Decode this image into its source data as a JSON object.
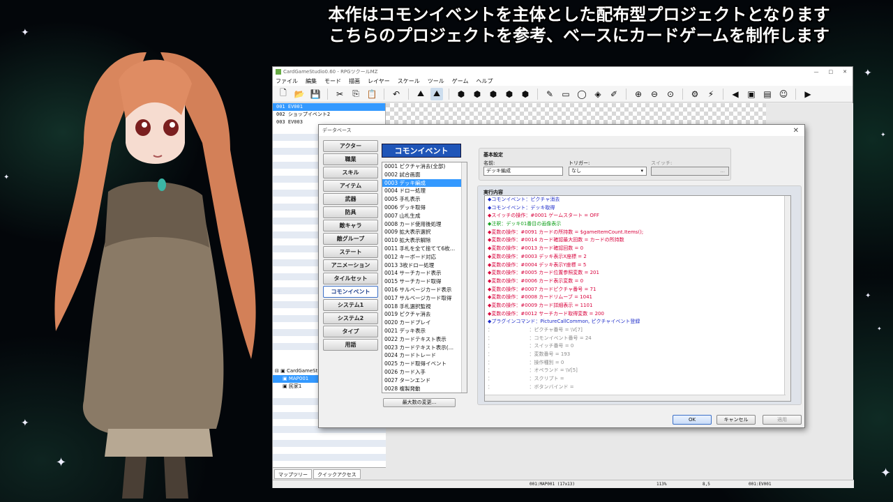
{
  "caption": {
    "line1": "本作はコモンイベントを主体とした配布型プロジェクトとなります",
    "line2": "こちらのプロジェクトを参考、ベースにカードゲームを制作します"
  },
  "window": {
    "title": "CardGameStudio0.60 - RPGツクールMZ",
    "controls": [
      "—",
      "□",
      "✕"
    ]
  },
  "menu": [
    "ファイル",
    "編集",
    "モード",
    "描画",
    "レイヤー",
    "スケール",
    "ツール",
    "ゲーム",
    "ヘルプ"
  ],
  "left_events": [
    {
      "label": "001 EV001",
      "selected": true
    },
    {
      "label": "002 ショップイベント2",
      "selected": false
    },
    {
      "label": "003 EV003",
      "selected": false
    }
  ],
  "map_tree": [
    {
      "label": "CardGameStudio",
      "selected": false
    },
    {
      "label": "MAP001",
      "selected": true
    },
    {
      "label": "民家1",
      "selected": false
    }
  ],
  "left_tabs": [
    "マップツリー",
    "クイックアクセス"
  ],
  "statusbar": {
    "map": "001:MAP001 (17x13)",
    "zoom": "113%",
    "coord": "8,5",
    "event": "001:EV001"
  },
  "dialog": {
    "title": "データベース",
    "close": "✕",
    "categories": [
      "アクター",
      "職業",
      "スキル",
      "アイテム",
      "武器",
      "防具",
      "敵キャラ",
      "敵グループ",
      "ステート",
      "アニメーション",
      "タイルセット",
      "コモンイベント",
      "システム1",
      "システム2",
      "タイプ",
      "用語"
    ],
    "selected_category": "コモンイベント",
    "list_header": "コモンイベント",
    "common_events": [
      "0001 ピクチャ消去(全部)",
      "0002 試合画面",
      "0003 デッキ編成",
      "0004 ドロー処理",
      "0005 手札表示",
      "0006 デッキ取得",
      "0007 山札生成",
      "0008 カード使用後処理",
      "0009 拡大表示選択",
      "0010 拡大表示解除",
      "0011 手札を全て捨てて6枚…",
      "0012 キーボード対応",
      "0013 3枚ドロー処理",
      "0014 サーチカード表示",
      "0015 サーチカード取得",
      "0016 サルベージカード表示",
      "0017 サルベージカード取得",
      "0018 手札選択監視",
      "0019 ピクチャ消去",
      "0020 カードプレイ",
      "0021 デッキ表示",
      "0022 カードテキスト表示",
      "0023 カードテキスト表示(…",
      "0024 カードトレード",
      "0025 カード取得イベント",
      "0026 カード入手",
      "0027 ターンエンド",
      "0028 複製発動"
    ],
    "selected_index": 2,
    "max_button": "最大数の変更...",
    "basic": {
      "section": "基本設定",
      "name_label": "名前:",
      "name_value": "デッキ編成",
      "trigger_label": "トリガー:",
      "trigger_value": "なし",
      "switch_label": "スイッチ:",
      "switch_button": "..."
    },
    "exec": {
      "section": "実行内容",
      "commands": [
        {
          "text": "◆コモンイベント：ピクチャ消去",
          "color": "blue"
        },
        {
          "text": "◆コモンイベント：デッキ取得",
          "color": "blue"
        },
        {
          "text": "◆スイッチの操作：#0001 ゲームスタート = OFF",
          "color": "red"
        },
        {
          "text": "◆注釈：デッキ01番目の画像表示",
          "color": "green"
        },
        {
          "text": "◆変数の操作：#0091 カードの所持数 = $gameItemCount.Items();",
          "color": "red"
        },
        {
          "text": "◆変数の操作：#0014 カード確認最大回数 = カードの所持数",
          "color": "red"
        },
        {
          "text": "◆変数の操作：#0013 カード確認回数 = 0",
          "color": "red"
        },
        {
          "text": "◆変数の操作：#0003 デッキ表示X座標 = 2",
          "color": "red"
        },
        {
          "text": "◆変数の操作：#0004 デッキ表示Y座標 = 5",
          "color": "red"
        },
        {
          "text": "◆変数の操作：#0005 カード位置参照変数 = 201",
          "color": "red"
        },
        {
          "text": "◆変数の操作：#0006 カード表示変数 = 0",
          "color": "red"
        },
        {
          "text": "◆変数の操作：#0007 カードピクチャ番号 = 71",
          "color": "red"
        },
        {
          "text": "◆変数の操作：#0008 カードリムーブ = 1041",
          "color": "red"
        },
        {
          "text": "◆変数の操作：#0009 カード詳細表示 = 1101",
          "color": "red"
        },
        {
          "text": "◆変数の操作：#0012 サーチカード取得変数 = 200",
          "color": "red"
        },
        {
          "text": "◆プラグインコマンド：PictureCallCommon, ピクチャイベント登録",
          "color": "blue"
        },
        {
          "text": "：　　　　　　　　：ピクチャ番号 = \\V[7]",
          "color": "grey"
        },
        {
          "text": "：　　　　　　　　：コモンイベント番号 = 24",
          "color": "grey"
        },
        {
          "text": "：　　　　　　　　：スイッチ番号 = 0",
          "color": "grey"
        },
        {
          "text": "：　　　　　　　　：変数番号 = 193",
          "color": "grey"
        },
        {
          "text": "：　　　　　　　　：操作種別 = 0",
          "color": "grey"
        },
        {
          "text": "：　　　　　　　　：オペランド = \\V[5]",
          "color": "grey"
        },
        {
          "text": "：　　　　　　　　：スクリプト =",
          "color": "grey"
        },
        {
          "text": "：　　　　　　　　：ボタンバインド =",
          "color": "grey"
        }
      ]
    },
    "buttons": {
      "ok": "OK",
      "cancel": "キャンセル",
      "apply": "適用"
    }
  },
  "colors": {
    "accent": "#1f55b8",
    "selection": "#3399ff",
    "cmd_blue": "#1c2bc9",
    "cmd_red": "#d8003b",
    "cmd_green": "#14a11f",
    "cmd_grey": "#8a8a8a"
  }
}
